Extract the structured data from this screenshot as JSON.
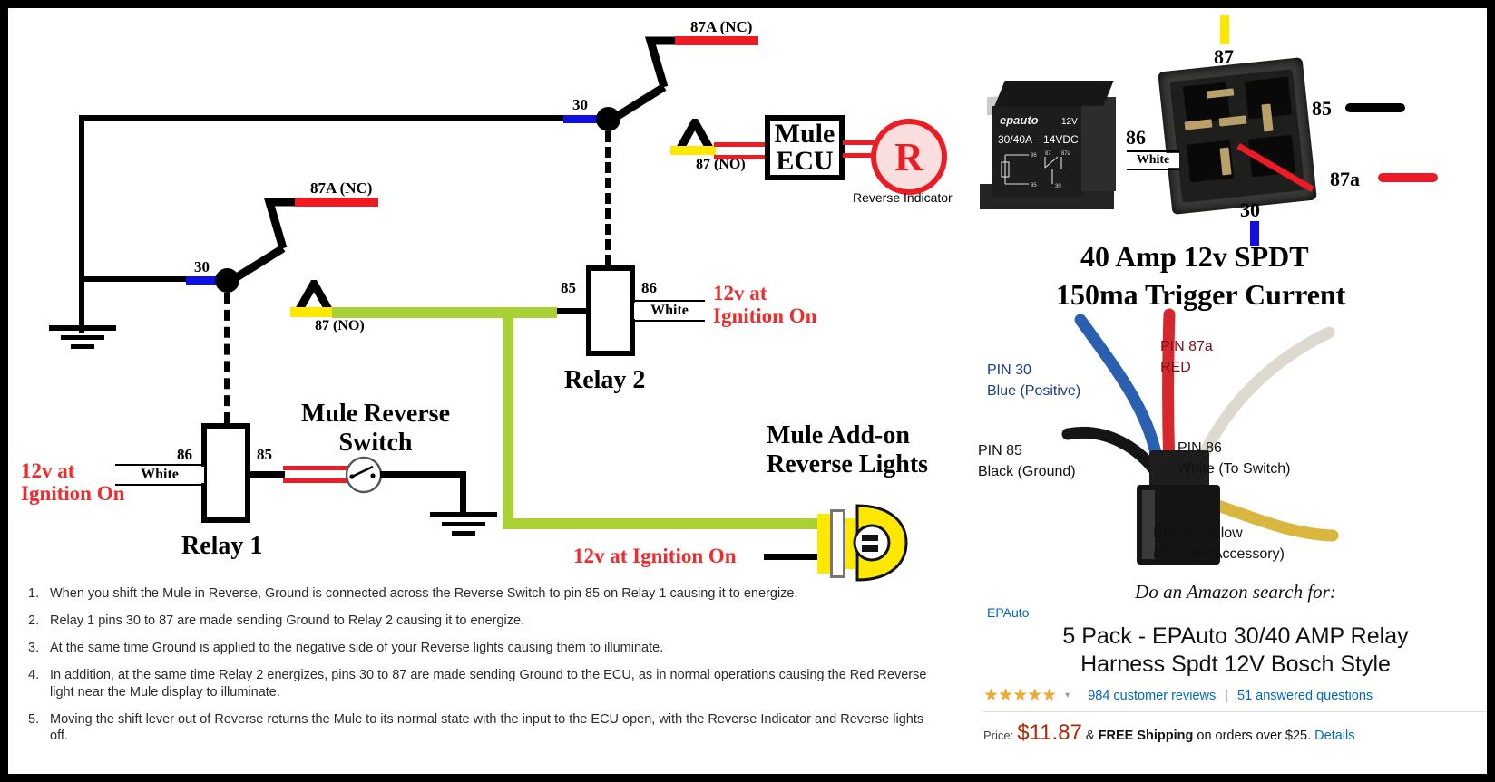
{
  "diagram": {
    "relay1": {
      "title": "Relay 1",
      "pin30": "30",
      "pin87a": "87A (NC)",
      "pin87": "87 (NO)",
      "pin85": "85",
      "pin86": "86",
      "wire86_label": "White",
      "note_12v": "12v at\nIgnition On",
      "note_12v_line1": "12v at",
      "note_12v_line2": "Ignition On"
    },
    "relay2": {
      "title": "Relay 2",
      "pin30": "30",
      "pin87a": "87A (NC)",
      "pin87": "87 (NO)",
      "pin85": "85",
      "pin86": "86",
      "wire86_label": "White",
      "note_12v_line1": "12v at",
      "note_12v_line2": "Ignition On"
    },
    "switch": {
      "title_line1": "Mule Reverse",
      "title_line2": "Switch"
    },
    "ecu": {
      "line1": "Mule",
      "line2": "ECU"
    },
    "indicator": {
      "glyph": "R",
      "caption": "Reverse Indicator"
    },
    "lights": {
      "title_line1": "Mule Add-on",
      "title_line2": "Reverse Lights",
      "note_12v": "12v at Ignition On"
    }
  },
  "relay_spec": {
    "pin87": "87",
    "pin85": "85",
    "pin86": "86",
    "pin86_sub": "White",
    "pin87a": "87a",
    "pin30": "30",
    "title_line1": "40 Amp  12v SPDT",
    "title_line2": "150ma Trigger Current",
    "photo_label_brand": "epauto",
    "photo_label_amp": "30/40A",
    "photo_label_volt": "14VDC",
    "photo_label_12v": "12V"
  },
  "harness": {
    "pin30_line1": "PIN 30",
    "pin30_line2": "Blue (Positive)",
    "pin87a_line1": "PIN 87a",
    "pin87a_line2": "RED",
    "pin85_line1": "PIN 85",
    "pin85_line2": "Black (Ground)",
    "pin86_line1": "PIN 86",
    "pin86_line2": "White (To Switch)",
    "pin87_line1": "PIN 87 Yellow",
    "pin87_line2": "(To Light/Accessory)"
  },
  "amazon": {
    "search_prompt": "Do an Amazon search for:",
    "brand": "EPAuto",
    "title_line1": "5 Pack - EPAuto 30/40 AMP Relay",
    "title_line2": "Harness Spdt 12V Bosch Style",
    "stars": "★★★★★",
    "caret": "▾",
    "reviews": "984 customer reviews",
    "separator": "|",
    "questions": "51 answered questions",
    "price_label": "Price:",
    "price": "$11.87",
    "shipping_amp": "&",
    "shipping_free": "FREE Shipping",
    "shipping_rest": "on orders over $25.",
    "details": "Details"
  },
  "instructions": [
    {
      "num": "1.",
      "text": "When you shift the Mule in Reverse, Ground is connected across the Reverse Switch to pin 85 on Relay 1 causing it to energize."
    },
    {
      "num": "2.",
      "text": "Relay 1 pins 30 to 87 are made sending Ground to Relay 2 causing it to energize."
    },
    {
      "num": "3.",
      "text": "At the same time Ground is applied to the negative side of your Reverse lights causing them to illuminate."
    },
    {
      "num": "4.",
      "text": "In addition, at the same time Relay 2 energizes, pins 30 to 87 are made sending Ground to the ECU, as in normal operations causing the Red Reverse light near the Mule display to illuminate."
    },
    {
      "num": "5.",
      "text": "Moving the shift lever out of Reverse returns the Mule to its normal state with the input to the ECU open, with the Reverse Indicator and Reverse lights off."
    }
  ],
  "colors": {
    "wire_blue": "#1010e0",
    "wire_red": "#ed1c24",
    "wire_yellow": "#ffe800",
    "wire_green": "#a7d135",
    "note_red": "#ef2b2b",
    "link_blue": "#0066c0",
    "price_red": "#b12704",
    "star_gold": "#f0a830"
  }
}
